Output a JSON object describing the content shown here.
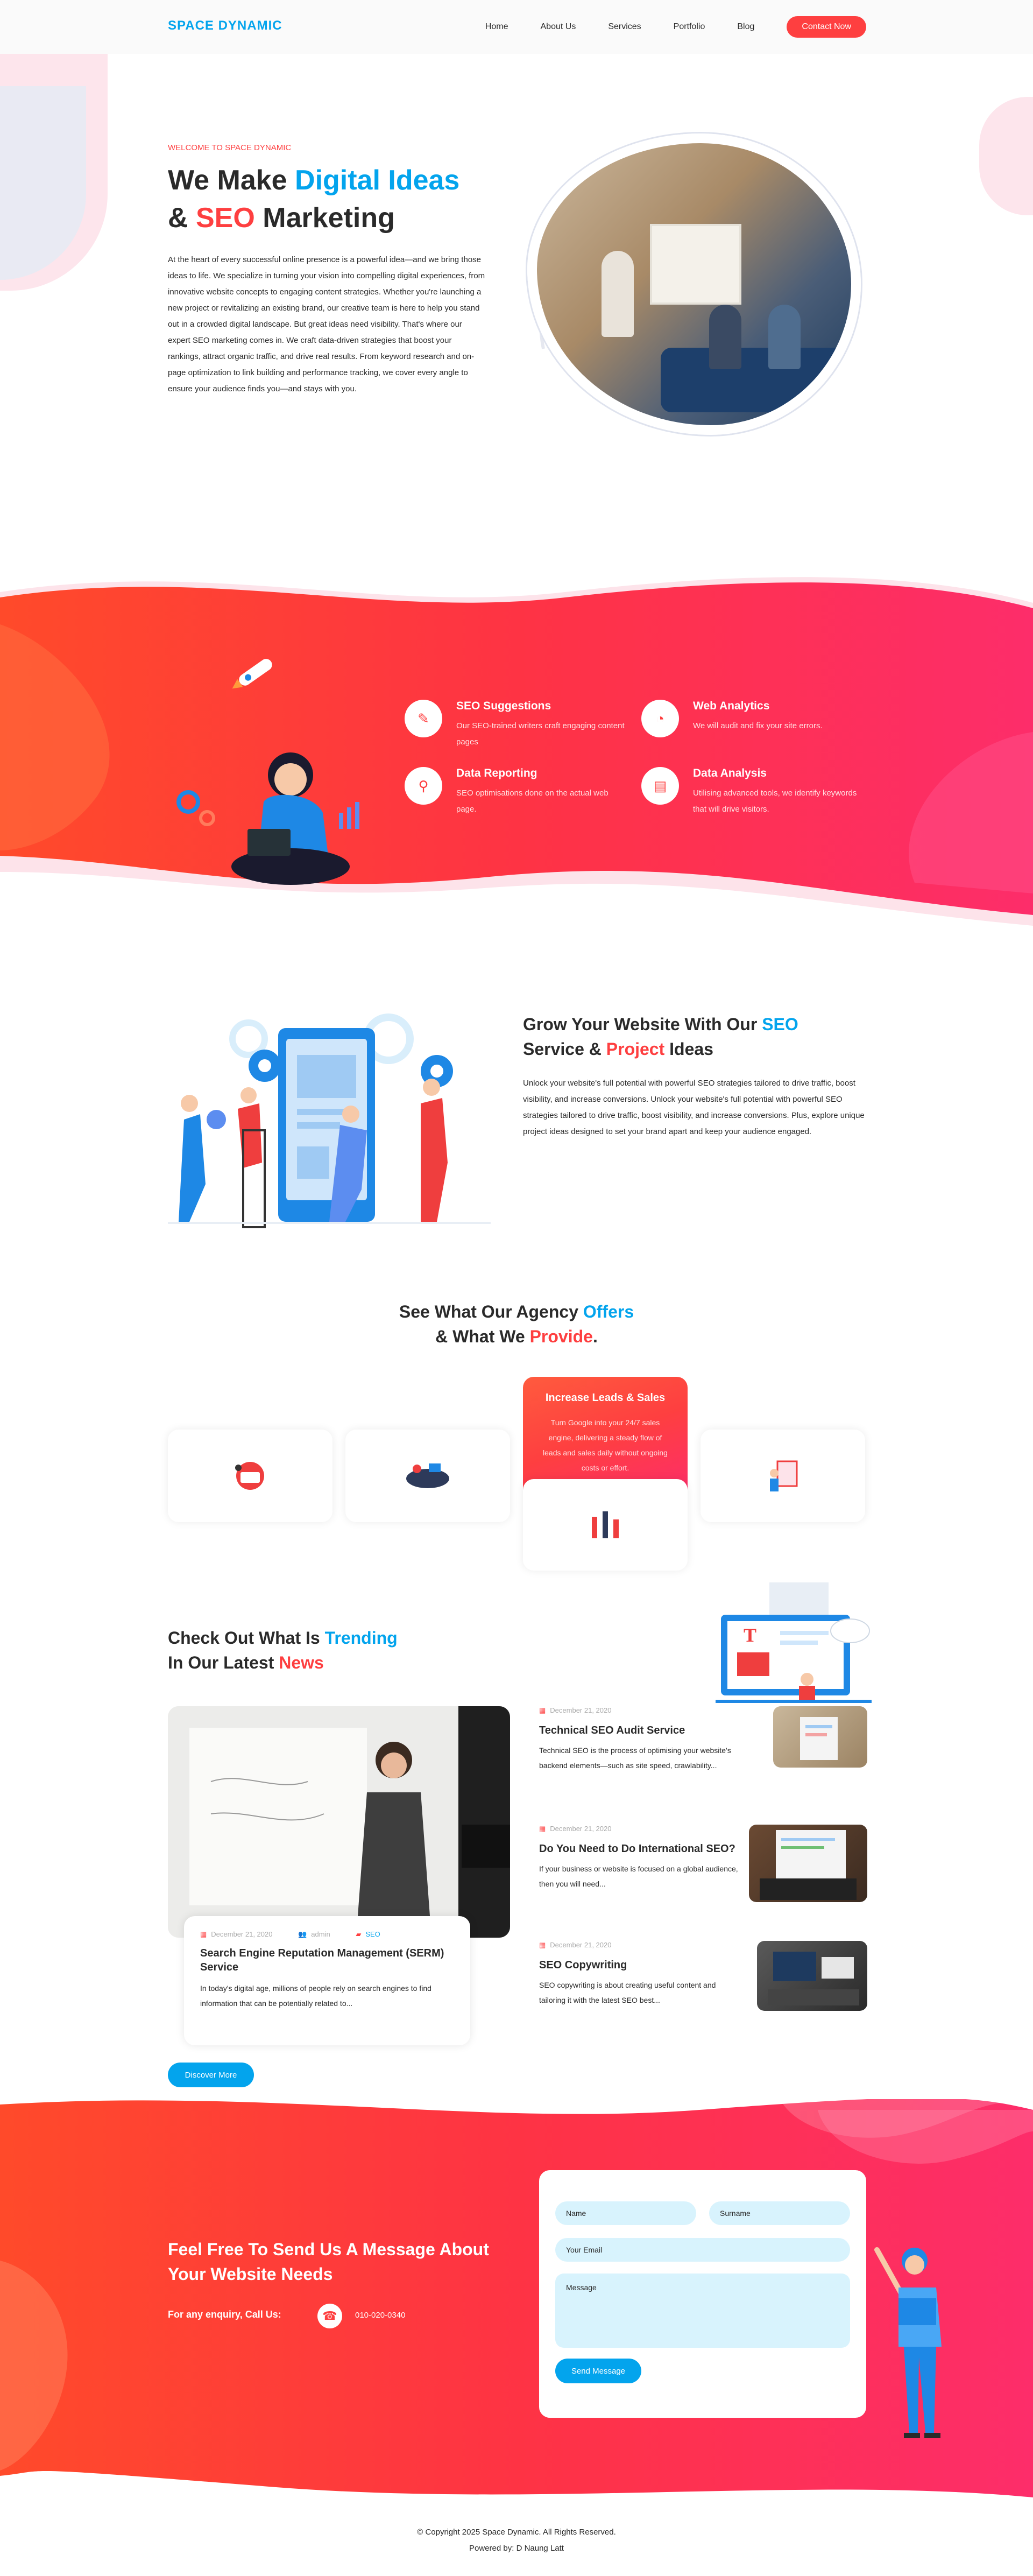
{
  "header": {
    "logo": "SPACE DYNAMIC",
    "nav": [
      "Home",
      "About Us",
      "Services",
      "Portfolio",
      "Blog"
    ],
    "contact_button": "Contact Now"
  },
  "hero": {
    "subtitle": "WELCOME TO SPACE DYNAMIC",
    "title_part1": "We Make ",
    "title_highlight1": "Digital Ideas",
    "title_part2": "& ",
    "title_highlight2": "SEO",
    "title_part3": " Marketing",
    "text": "At the heart of every successful online presence is a powerful idea—and we bring those ideas to life. We specialize in turning your vision into compelling digital experiences, from innovative website concepts to engaging content strategies. Whether you're launching a new project or revitalizing an existing brand, our creative team is here to help you stand out in a crowded digital landscape. But great ideas need visibility. That's where our expert SEO marketing comes in. We craft data-driven strategies that boost your rankings, attract organic traffic, and drive real results. From keyword research and on-page optimization to link building and performance tracking, we cover every angle to ensure your audience finds you—and stays with you."
  },
  "services": [
    {
      "icon": "seo-suggestion-icon",
      "title": "SEO Suggestions",
      "text": "Our SEO-trained writers craft engaging content pages"
    },
    {
      "icon": "web-analytics-icon",
      "title": "Web Analytics",
      "text": "We will audit and fix your site errors."
    },
    {
      "icon": "data-reporting-icon",
      "title": "Data Reporting",
      "text": "SEO optimisations done on the actual web page."
    },
    {
      "icon": "data-analysis-icon",
      "title": "Data Analysis",
      "text": "Utilising advanced tools, we identify keywords that will drive visitors."
    }
  ],
  "about": {
    "title_part1": "Grow Your Website With Our ",
    "title_highlight1": "SEO",
    "title_part2": "Service & ",
    "title_highlight2": "Project",
    "title_part3": " Ideas",
    "text": "Unlock your website's full potential with powerful SEO strategies tailored to drive traffic, boost visibility, and increase conversions. Unlock your website's full potential with powerful SEO strategies tailored to drive traffic, boost visibility, and increase conversions. Plus, explore unique project ideas designed to set your brand apart and keep your audience engaged."
  },
  "offers": {
    "title_part1": "See What Our Agency ",
    "title_highlight1": "Offers",
    "title_part2": "& What We ",
    "title_highlight2": "Provide",
    "title_part3": ".",
    "active_card": {
      "title": "Increase Leads & Sales",
      "text": "Turn Google into your 24/7 sales engine, delivering a steady flow of leads and sales daily without ongoing costs or effort."
    }
  },
  "blog": {
    "title_part1": "Check Out What Is ",
    "title_highlight1": "Trending",
    "title_part2": "In Our Latest ",
    "title_highlight2": "News",
    "featured": {
      "date": "December 21, 2020",
      "author": "admin",
      "category": "SEO",
      "title": "Search Engine Reputation Management (SERM) Service",
      "text": "In today's digital age, millions of people rely on search engines to find information that can be potentially related to..."
    },
    "posts": [
      {
        "date": "December 21, 2020",
        "title": "Technical SEO Audit Service",
        "text": "Technical SEO is the process of optimising your website's backend elements—such as site speed, crawlability..."
      },
      {
        "date": "December 21, 2020",
        "title": "Do You Need to Do International SEO?",
        "text": "If your business or website is focused on a global audience, then you will need..."
      },
      {
        "date": "December 21, 2020",
        "title": "SEO Copywriting",
        "text": "SEO copywriting is about creating useful content and tailoring it with the latest SEO best..."
      }
    ],
    "discover_button": "Discover More"
  },
  "contact": {
    "title": "Feel Free To Send Us A Message About Your Website Needs",
    "enquiry_label": "For any enquiry, Call Us:",
    "phone": "010-020-0340",
    "form": {
      "name_placeholder": "Name",
      "surname_placeholder": "Surname",
      "email_placeholder": "Your Email",
      "message_placeholder": "Message",
      "send_button": "Send Message"
    }
  },
  "footer": {
    "copyright": "© Copyright 2025 Space Dynamic. All Rights Reserved.",
    "powered": "Powered by: D Naung Latt"
  },
  "colors": {
    "brand_blue": "#03a4ed",
    "brand_red": "#fe3f40"
  }
}
